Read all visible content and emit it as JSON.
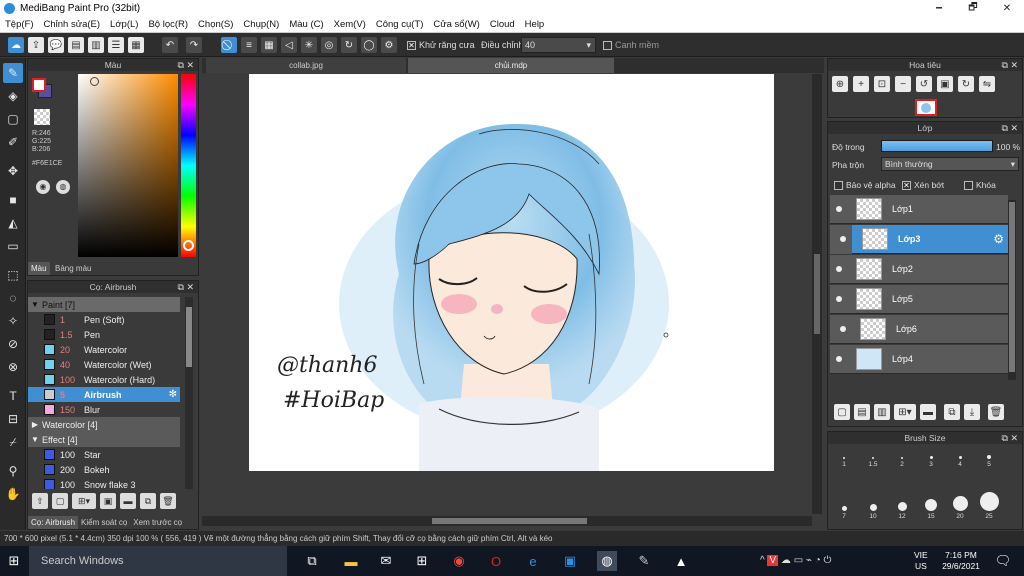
{
  "window": {
    "title": "MediBang Paint Pro (32bit)",
    "minimize": "🗕",
    "maximize": "🗗",
    "close": "✕"
  },
  "menu": [
    "Tệp(F)",
    "Chỉnh sửa(E)",
    "Lớp(L)",
    "Bộ lọc(R)",
    "Chọn(S)",
    "Chụp(N)",
    "Màu (C)",
    "Xem(V)",
    "Công cụ(T)",
    "Cửa sổ(W)",
    "Cloud",
    "Help"
  ],
  "toolbar": {
    "antialias_label": "Khử răng cưa",
    "correction_label": "Điều chỉnh",
    "correction_value": "40",
    "snap_label": "Canh mềm"
  },
  "color_panel": {
    "title": "Màu",
    "r": "R:246",
    "g": "G:225",
    "b": "B:206",
    "hex": "#F6E1CE",
    "tab_color": "Màu",
    "tab_palette": "Bảng màu",
    "fg": "#f6e1ce"
  },
  "brush_panel": {
    "title": "Cọ: Airbrush",
    "groups": [
      {
        "name": "Paint [7]",
        "expanded": true
      },
      {
        "name": "Watercolor [4]",
        "expanded": false
      },
      {
        "name": "Effect [4]",
        "expanded": true
      }
    ],
    "paint_brushes": [
      {
        "size": "1",
        "name": "Pen (Soft)",
        "color": "#222222"
      },
      {
        "size": "1.5",
        "name": "Pen",
        "color": "#222222"
      },
      {
        "size": "20",
        "name": "Watercolor",
        "color": "#6fd3ef"
      },
      {
        "size": "40",
        "name": "Watercolor (Wet)",
        "color": "#6fd3ef"
      },
      {
        "size": "100",
        "name": "Watercolor (Hard)",
        "color": "#6fd3ef"
      },
      {
        "size": "5",
        "name": "Airbrush",
        "color": "#cccccc"
      },
      {
        "size": "150",
        "name": "Blur",
        "color": "#f7a8e0"
      }
    ],
    "effect_brushes": [
      {
        "size": "100",
        "name": "Star",
        "color": "#3d5be0"
      },
      {
        "size": "200",
        "name": "Bokeh",
        "color": "#3d5be0"
      },
      {
        "size": "100",
        "name": "Snow flake 3",
        "color": "#3d5be0"
      }
    ],
    "tabs": [
      "Cọ: Airbrush",
      "Kiểm soát cọ",
      "Xem trước cọ"
    ]
  },
  "canvas": {
    "tabs": [
      "collab.jpg",
      "chủi.mdp"
    ],
    "active_tab": 1,
    "signature": "@thanh6\n#HoiBap"
  },
  "navigator": {
    "title": "Hoa tiêu"
  },
  "layer_panel": {
    "title": "Lớp",
    "opacity_label": "Độ trong",
    "opacity_value": "100 %",
    "opacity_fraction": 1.0,
    "blend_label": "Pha trộn",
    "blend_value": "Bình thường",
    "protect_alpha": "Bảo vệ alpha",
    "clipping": "Xén bớt",
    "lock": "Khóa",
    "layers": [
      {
        "name": "Lớp1",
        "selected": false
      },
      {
        "name": "Lớp3",
        "selected": true
      },
      {
        "name": "Lớp2",
        "selected": false
      },
      {
        "name": "Lớp5",
        "selected": false
      },
      {
        "name": "Lớp6",
        "selected": false
      },
      {
        "name": "Lớp4",
        "selected": false
      }
    ]
  },
  "brush_size": {
    "title": "Brush Size",
    "sizes_row1": [
      "1",
      "1.5",
      "2",
      "3",
      "4",
      "5"
    ],
    "sizes_row2": [
      "7",
      "10",
      "12",
      "15",
      "20",
      "25"
    ]
  },
  "status_bar": {
    "text": "700 * 600 pixel   (5.1 * 4.4cm)   350 dpi   100 %   ( 556, 419 )   Vẽ một đường thẳng bằng cách giữ phím Shift, Thay đổi cỡ cọ bằng cách giữ phím Ctrl, Alt và kéo"
  },
  "taskbar": {
    "search_placeholder": "Search Windows",
    "lang1": "VIE",
    "lang2": "US",
    "time": "7:16 PM",
    "date": "29/6/2021"
  }
}
